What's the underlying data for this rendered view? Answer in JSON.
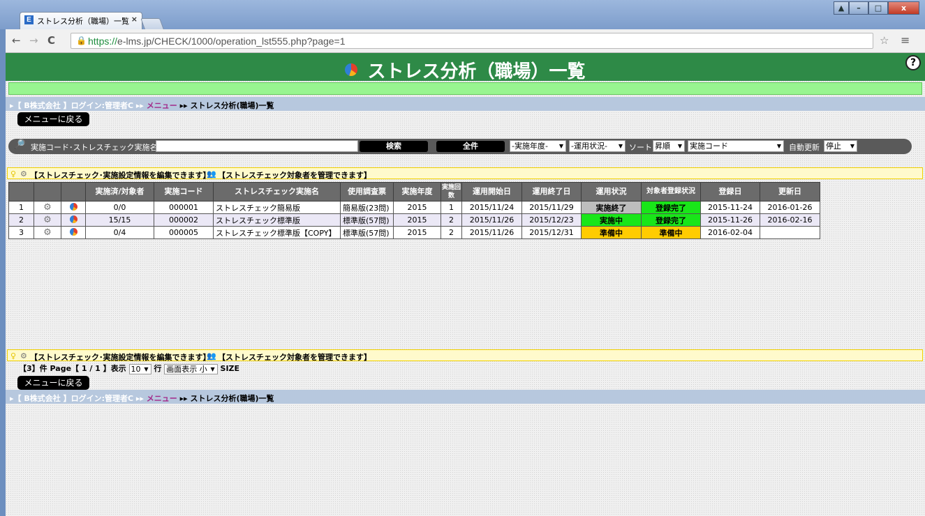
{
  "browser": {
    "tab_title": "ストレス分析（職場）一覧",
    "tab_favicon": "E",
    "tab_close": "×",
    "url_secure": "https://",
    "url_rest": "e-lms.jp/CHECK/1000/operation_lst555.php?page=1",
    "back": "←",
    "forward": "→",
    "reload": "C",
    "lock": "🔒",
    "star": "☆",
    "menu": "≡"
  },
  "window": {
    "restore": "▲",
    "min": "–",
    "max": "□",
    "close": "x"
  },
  "header": {
    "title": "ストレス分析（職場）一覧",
    "help": "?"
  },
  "breadcrumb": {
    "company": "▸【 B株式会社 】ログイン:管理者C ▸▸ ",
    "menu": "メニュー",
    "current": " ▸▸ ストレス分析(職場)一覧"
  },
  "back_button": "メニューに戻る",
  "search": {
    "label": "実施コード･ストレスチェック実施名",
    "value": "",
    "search_button": "検索",
    "all_button": "全件",
    "year_select": "-実施年度-",
    "status_select": "-運用状況-",
    "sort_label": "ソート",
    "order_select": "昇順",
    "sort_field_select": "実施コード",
    "auto_update_label": "自動更新",
    "auto_update_select": "停止"
  },
  "info": {
    "bulb": "♀",
    "gear": "⚙",
    "users": "👥",
    "edit_text": "【ストレスチェック･実施設定情報を編集できます】",
    "manage_text": "【ストレスチェック対象者を管理できます】"
  },
  "table": {
    "headers": [
      "",
      "",
      "",
      "実施済/対象者",
      "実施コード",
      "ストレスチェック実施名",
      "使用調査票",
      "実施年度",
      "実施回数",
      "運用開始日",
      "運用終了日",
      "運用状況",
      "対象者登録状況",
      "登録日",
      "更新日"
    ],
    "rows": [
      {
        "no": "1",
        "done": "0/0",
        "code": "000001",
        "name": "ストレスチェック簡易版",
        "sheet": "簡易版(23問)",
        "year": "2015",
        "times": "1",
        "start": "2015/11/24",
        "end": "2015/11/29",
        "status": "実施終了",
        "reg": "登録完了",
        "created": "2015-11-24",
        "updated": "2016-01-26"
      },
      {
        "no": "2",
        "done": "15/15",
        "code": "000002",
        "name": "ストレスチェック標準版",
        "sheet": "標準版(57問)",
        "year": "2015",
        "times": "2",
        "start": "2015/11/26",
        "end": "2015/12/23",
        "status": "実施中",
        "reg": "登録完了",
        "created": "2015-11-26",
        "updated": "2016-02-16"
      },
      {
        "no": "3",
        "done": "0/4",
        "code": "000005",
        "name": "ストレスチェック標準版【COPY】",
        "sheet": "標準版(57問)",
        "year": "2015",
        "times": "2",
        "start": "2015/11/26",
        "end": "2015/12/31",
        "status": "準備中",
        "reg": "準備中",
        "created": "2016-02-04",
        "updated": ""
      }
    ]
  },
  "pager": {
    "count": "【3】件",
    "page_label": "Page【 1 / 1 】表示",
    "per_page": "10",
    "row_label": "行",
    "view_select": "画面表示 小",
    "size_label": "SIZE"
  }
}
